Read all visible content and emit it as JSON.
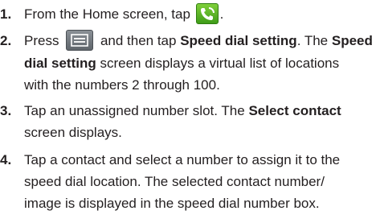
{
  "steps": [
    {
      "number": "1.",
      "text_before": "From the Home screen, tap",
      "icon": "phone-icon",
      "text_after": "."
    },
    {
      "number": "2.",
      "line1_before": "Press",
      "icon": "menu-icon",
      "line1_mid": "and then tap",
      "line1_bold": "Speed dial setting",
      "line1_after": ". The",
      "line1_bold2": "Speed",
      "line2_bold": "dial setting",
      "line2_after": "screen displays a virtual list of locations",
      "line3": "with the numbers 2 through 100."
    },
    {
      "number": "3.",
      "line1_before": "Tap an unassigned number slot. The",
      "line1_bold": "Select contact",
      "line2": "screen displays."
    },
    {
      "number": "4.",
      "line1": "Tap a contact and select a number to assign it to the",
      "line2": "speed dial location. The selected contact number/",
      "line3": "image is displayed in the speed dial number box."
    }
  ],
  "colors": {
    "phone_icon": "#4caf22",
    "menu_icon": "#6b7177",
    "text": "#231f20"
  }
}
